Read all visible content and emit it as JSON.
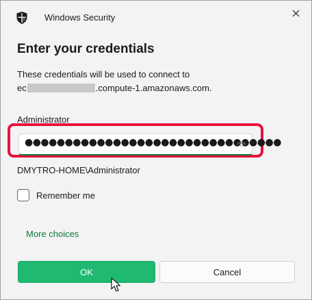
{
  "window": {
    "title": "Windows Security",
    "icon": "shield-icon",
    "close_icon": "close-icon"
  },
  "dialog": {
    "heading": "Enter your credentials",
    "description_line1": "These credentials will be used to connect to",
    "host_prefix": "ec",
    "host_suffix": ".compute-1.amazonaws.com.",
    "username": "Administrator",
    "password_value": "●●●●●●●●●●●●●●●●●●●●●●●●●●●●●●●●",
    "password_reveal_icon": "eye-icon",
    "domain_user": "DMYTRO-HOME\\Administrator",
    "remember_label": "Remember me",
    "remember_checked": false,
    "more_choices": "More choices"
  },
  "buttons": {
    "ok": "OK",
    "cancel": "Cancel"
  },
  "colors": {
    "accent_green": "#1fb971",
    "link_green": "#0f7b3b",
    "highlight_red": "#e8123c"
  }
}
